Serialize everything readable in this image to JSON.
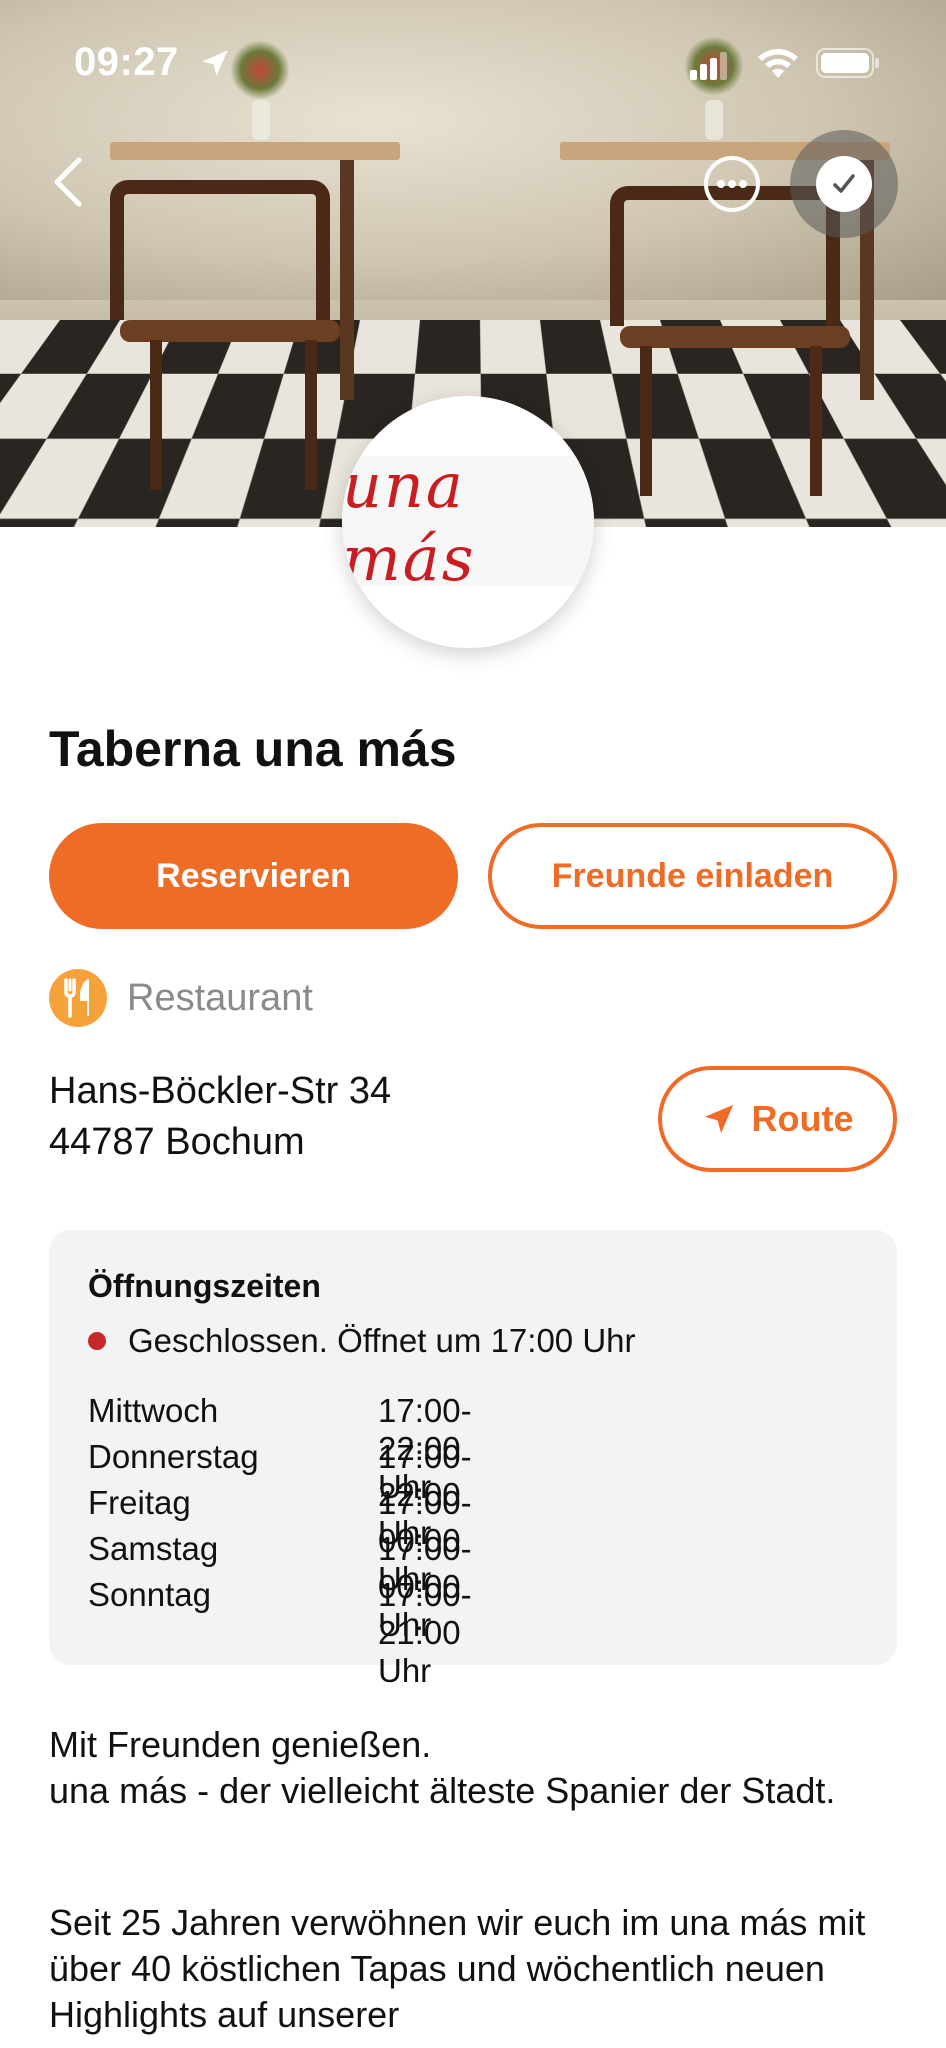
{
  "status_bar": {
    "time": "09:27"
  },
  "hero": {
    "logo_text": "una más"
  },
  "restaurant": {
    "name": "Taberna una más",
    "category": "Restaurant",
    "address_line1": "Hans-Böckler-Str 34",
    "address_line2": "44787 Bochum"
  },
  "actions": {
    "reserve": "Reservieren",
    "invite": "Freunde einladen",
    "route": "Route"
  },
  "hours": {
    "title": "Öffnungszeiten",
    "status": "Geschlossen. Öffnet um 17:00 Uhr",
    "rows": [
      {
        "day": "Mittwoch",
        "time": "17:00-22:00 Uhr"
      },
      {
        "day": "Donnerstag",
        "time": "17:00-22:00 Uhr"
      },
      {
        "day": "Freitag",
        "time": "17:00-00:00 Uhr"
      },
      {
        "day": "Samstag",
        "time": "17:00-00:00 Uhr"
      },
      {
        "day": "Sonntag",
        "time": "17:00-21:00 Uhr"
      }
    ]
  },
  "description": {
    "p1": "Mit Freunden genießen.\nuna más - der vielleicht älteste Spanier der Stadt.",
    "p2": "Seit 25 Jahren verwöhnen wir euch im una más mit über 40 köstlichen Tapas und wöchentlich neuen Highlights auf unserer"
  },
  "colors": {
    "accent": "#ee6c26",
    "category_icon": "#f5a23a",
    "closed_dot": "#c62828",
    "card_bg": "#f3f3f3"
  },
  "icons": [
    "location-arrow-icon",
    "signal-icon",
    "wifi-icon",
    "battery-icon",
    "back-chevron-icon",
    "more-icon",
    "checkmark-icon",
    "cutlery-icon",
    "navigation-arrow-icon"
  ]
}
